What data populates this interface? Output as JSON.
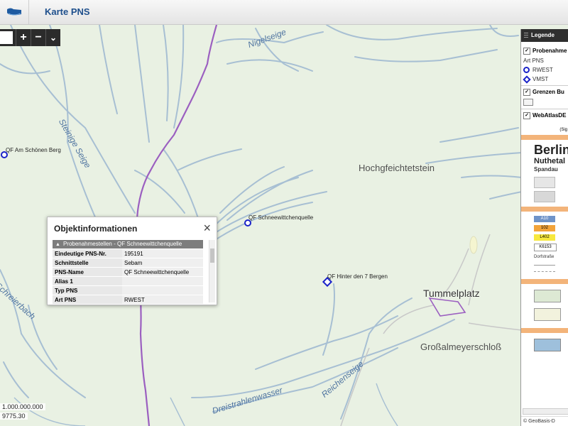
{
  "app": {
    "title": "Karte PNS",
    "logo": "pns-logo-icon"
  },
  "map": {
    "labels": {
      "nigelseige": "Nigelseige",
      "steinige_seige": "Steinige Seige",
      "schreierbach": "Schreierbach",
      "dreistrahlenwasser": "Dreistrahlenwasser",
      "reichenseige": "Reichenseige"
    },
    "places": {
      "hochgfeichtetstein": "Hochgfeichtetstein",
      "tummelplatz": "Tummelplatz",
      "grossalmeyerschloss": "Großalmeyerschloß"
    },
    "points": {
      "am_schoenen_berg": "QF Am Schönen Berg",
      "schneewittchenquelle": "QF Schneewittchenquelle",
      "hinter_den_7_bergen": "QF Hinter den 7 Bergen"
    },
    "zoom": {
      "in": "+",
      "out": "−",
      "menu": "⌄"
    },
    "scale": {
      "line1": "1.000.000.000",
      "line2": "9775.30"
    }
  },
  "popup": {
    "title": "Objektinformationen",
    "close": "×",
    "section": "Probenahmestellen - QF Schneewittchenquelle",
    "rows": [
      {
        "key": "Eindeutige PNS-Nr.",
        "value": "195191"
      },
      {
        "key": "Schnittstelle",
        "value": "Sebam"
      },
      {
        "key": "PNS-Name",
        "value": "QF Schneewittchenquelle"
      },
      {
        "key": "Alias 1",
        "value": ""
      },
      {
        "key": "Typ PNS",
        "value": ""
      },
      {
        "key": "Art PNS",
        "value": "RWEST"
      }
    ]
  },
  "legend": {
    "title": "Legende",
    "groups": {
      "probenahme": "Probenahme",
      "art_pns": "Art PNS",
      "rwest": "RWEST",
      "vmst": "VMST",
      "grenzen": "Grenzen Bu",
      "webatlas": "WebAtlasDE"
    },
    "sig": "(Sig",
    "berlin": "Berlin",
    "nuthetal": "Nuthetal",
    "spandau": "Spandau",
    "road_codes": [
      "A10",
      "102",
      "L402",
      "K6153",
      "Dorfstraße"
    ],
    "footer": "© GeoBasis-D",
    "colors": {
      "road_blue": "#6f93c8",
      "road_orange": "#f2a33a",
      "road_yellow": "#f7e83e",
      "orange_band": "#f3b47a"
    }
  }
}
